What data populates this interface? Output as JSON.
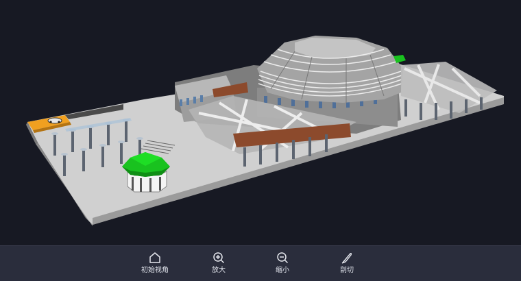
{
  "toolbar": {
    "home_label": "初始视角",
    "zoom_in_label": "放大",
    "zoom_out_label": "缩小",
    "section_label": "剖切"
  },
  "icons": {
    "home": "home-icon",
    "zoom_in": "zoom-in-icon",
    "zoom_out": "zoom-out-icon",
    "section": "section-cut-icon"
  },
  "colors": {
    "background": "#171923",
    "toolbar": "#2a2d3c",
    "ground": "#c9c9c9",
    "dome": "#9a9a9a",
    "accent_green": "#19c21f",
    "accent_orange": "#f0a020",
    "brick": "#8c4a2c"
  }
}
